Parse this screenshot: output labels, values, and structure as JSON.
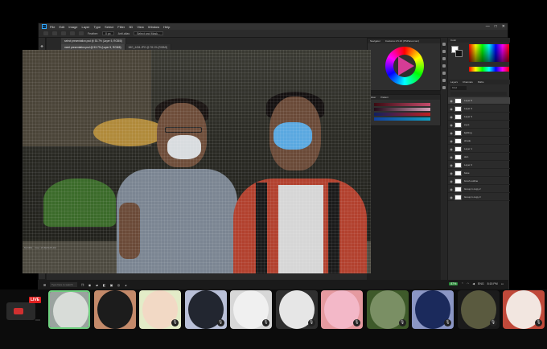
{
  "app": {
    "menu": [
      "File",
      "Edit",
      "Image",
      "Layer",
      "Type",
      "Select",
      "Filter",
      "3D",
      "View",
      "Window",
      "Help"
    ],
    "window_controls": [
      "—",
      "□",
      "✕"
    ]
  },
  "options_bar": {
    "feather_label": "Feather:",
    "feather_value": "0 px",
    "anti_alias": "Anti-alias",
    "select_mask": "Select and Mask..."
  },
  "tabs_row1": [
    {
      "label": "select presentation.psd @ 53.7% (Layer 5, RGB/8)"
    }
  ],
  "tabs_row2": [
    {
      "label": "meet presentation.psd @ 53.7% (Layer 5, RGB/8)",
      "active": true
    },
    {
      "label": "IMG_4434.JPG @ 78.1% (RGB/8)",
      "active": false
    }
  ],
  "status": {
    "zoom": "53.68%",
    "doc": "Doc: 15.6M/125.4M"
  },
  "colorwheel_panel": {
    "tabs": [
      "Navigator",
      "Coolorus 2.5.16 (PSPanel.com)"
    ]
  },
  "sliders_panel": {
    "tabs": [
      "Mixer",
      "Pattern"
    ]
  },
  "right_panels": {
    "color_tabs": [
      "Color"
    ],
    "layer_tabs": [
      "Layers",
      "Channels",
      "Paths"
    ],
    "search_placeholder": "Kind"
  },
  "layers": [
    {
      "name": "Layer 5",
      "selected": true
    },
    {
      "name": "Layer 4",
      "selected": false
    },
    {
      "name": "Layer 3",
      "selected": false
    },
    {
      "name": "eyes",
      "selected": false
    },
    {
      "name": "lighting",
      "selected": false
    },
    {
      "name": "shade",
      "selected": false
    },
    {
      "name": "Layer 1",
      "selected": false
    },
    {
      "name": "skin",
      "selected": false
    },
    {
      "name": "Layer 2",
      "selected": false
    },
    {
      "name": "base",
      "selected": false
    },
    {
      "name": "brush outline",
      "selected": false
    },
    {
      "name": "Group 1 copy 2",
      "selected": false
    },
    {
      "name": "Group 1 copy 3",
      "selected": false
    }
  ],
  "taskbar": {
    "search_placeholder": "Type here to search",
    "battery": "87%",
    "time": "8:15 PM",
    "lang": "ENG"
  },
  "stream": {
    "live_label": "LIVE"
  },
  "participants": [
    {
      "id": "p1",
      "bg": "#9aa39f",
      "avatar": "#d8dcd8",
      "active": true
    },
    {
      "id": "p2",
      "bg": "#c48a6a",
      "avatar": "#1c1c1c",
      "active": false
    },
    {
      "id": "p3",
      "bg": "#e3ecc8",
      "avatar": "#f2d9c5",
      "active": false
    },
    {
      "id": "p4",
      "bg": "#b9c0d8",
      "avatar": "#222630",
      "active": false
    },
    {
      "id": "p5",
      "bg": "#d7d7d7",
      "avatar": "#f0f0f0",
      "active": false
    },
    {
      "id": "p6",
      "bg": "#2f2f2f",
      "avatar": "#e6e6e6",
      "active": false
    },
    {
      "id": "p7",
      "bg": "#e59aa0",
      "avatar": "#f3b8c8",
      "active": false
    },
    {
      "id": "p8",
      "bg": "#3e5a2a",
      "avatar": "#7a8f64",
      "active": false
    },
    {
      "id": "p9",
      "bg": "#8b96c4",
      "avatar": "#1b2a5c",
      "active": false
    },
    {
      "id": "p10",
      "bg": "#1b1b1b",
      "avatar": "#5a5a3f",
      "active": false
    },
    {
      "id": "p11",
      "bg": "#c0493a",
      "avatar": "#f2e6e0",
      "active": false
    }
  ],
  "colors": {
    "photoshop_bg": "#1e1e1e",
    "live": "#e02020",
    "accent_green": "#6fd07f"
  }
}
